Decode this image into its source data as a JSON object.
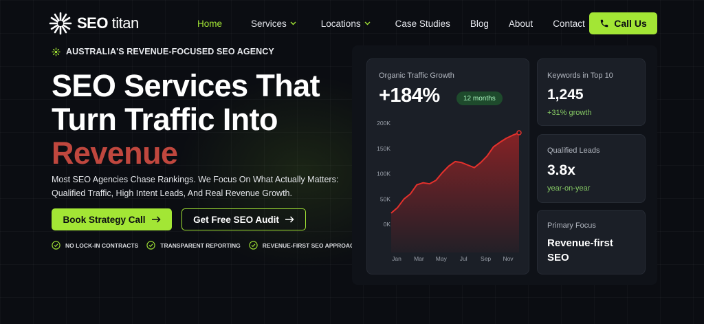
{
  "brand": {
    "logo_bold": "SEO",
    "logo_light": "titan",
    "accent_color": "#a3e635",
    "highlight_color": "#c0473e"
  },
  "nav": {
    "items": [
      {
        "label": "Home",
        "active": true
      },
      {
        "label": "Services",
        "dropdown": true
      },
      {
        "label": "Locations",
        "dropdown": true
      },
      {
        "label": "Case Studies"
      },
      {
        "label": "Blog"
      },
      {
        "label": "About"
      },
      {
        "label": "Contact"
      }
    ],
    "cta_label": "Call Us",
    "cta_icon": "phone-icon"
  },
  "hero": {
    "eyebrow": "AUSTRALIA'S REVENUE-FOCUSED SEO AGENCY",
    "title_line1": "SEO Services That",
    "title_line2": "Turn Traffic Into",
    "title_accent": "Revenue",
    "description": "Most SEO Agencies Chase Rankings. We Focus On What Actually Matters: Qualified Traffic, High Intent Leads, And Real Revenue Growth.",
    "primary_cta": "Book Strategy Call",
    "secondary_cta": "Get Free SEO Audit",
    "checks": [
      "NO LOCK-IN CONTRACTS",
      "TRANSPARENT REPORTING",
      "REVENUE-FIRST SEO APPROACH"
    ]
  },
  "dashboard": {
    "traffic": {
      "title": "Organic Traffic Growth",
      "value": "+184%",
      "badge": "12 months"
    },
    "stats": [
      {
        "label": "Keywords in Top 10",
        "value": "1,245",
        "sub": "+31% growth"
      },
      {
        "label": "Qualified Leads",
        "value": "3.8x",
        "sub": "year-on-year"
      },
      {
        "label": "Primary Focus",
        "value": "Revenue-first SEO"
      }
    ]
  },
  "chart_data": {
    "type": "area",
    "x_ticks": [
      "Jan",
      "Mar",
      "May",
      "Jul",
      "Sep",
      "Nov"
    ],
    "y_ticks": [
      "200K",
      "150K",
      "100K",
      "50K",
      "0K"
    ],
    "ylim": [
      0,
      200000
    ],
    "series": [
      {
        "color": "#dc2626",
        "points": [
          {
            "x": 0,
            "y": 22000
          },
          {
            "x": 0.5,
            "y": 33000
          },
          {
            "x": 1,
            "y": 50000
          },
          {
            "x": 1.5,
            "y": 60000
          },
          {
            "x": 2,
            "y": 78000
          },
          {
            "x": 2.5,
            "y": 82000
          },
          {
            "x": 3,
            "y": 80000
          },
          {
            "x": 3.5,
            "y": 87000
          },
          {
            "x": 4,
            "y": 102000
          },
          {
            "x": 4.5,
            "y": 115000
          },
          {
            "x": 5,
            "y": 124000
          },
          {
            "x": 5.5,
            "y": 122000
          },
          {
            "x": 6,
            "y": 117000
          },
          {
            "x": 6.5,
            "y": 112000
          },
          {
            "x": 7,
            "y": 122000
          },
          {
            "x": 7.5,
            "y": 135000
          },
          {
            "x": 8,
            "y": 153000
          },
          {
            "x": 8.5,
            "y": 162000
          },
          {
            "x": 9,
            "y": 170000
          },
          {
            "x": 9.5,
            "y": 176000
          },
          {
            "x": 10,
            "y": 181000
          }
        ]
      }
    ],
    "grid": false,
    "legend": "none"
  }
}
